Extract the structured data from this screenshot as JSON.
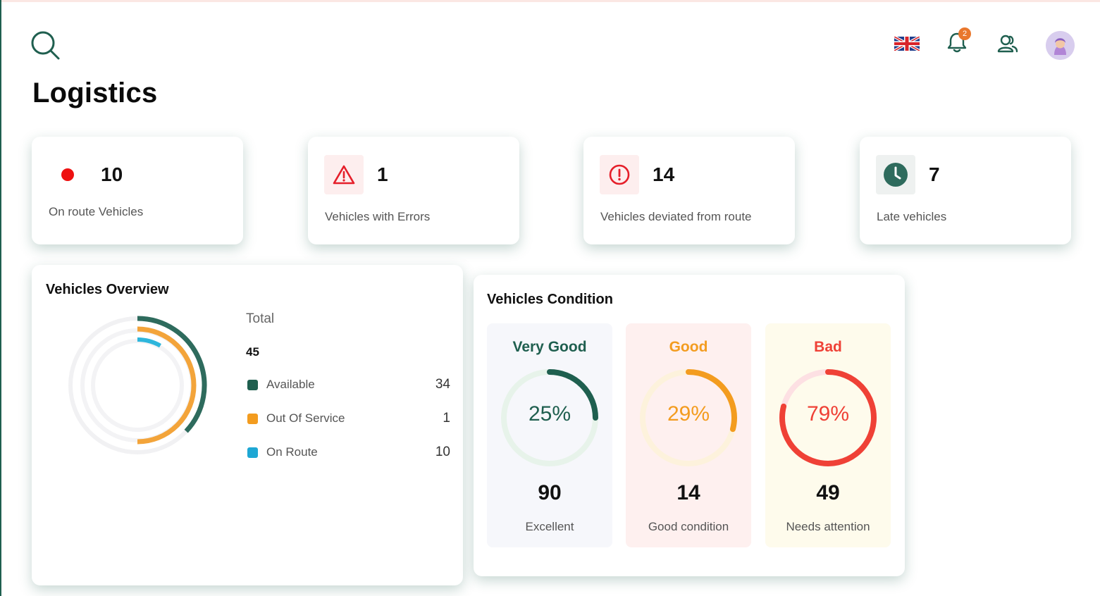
{
  "page": {
    "title": "Logistics"
  },
  "header": {
    "icons": {
      "search": "search-icon",
      "language": "uk-flag-icon",
      "notifications": "bell-icon",
      "users": "users-icon",
      "avatar": "avatar"
    },
    "notification_count": "2"
  },
  "stats": [
    {
      "value": "10",
      "label": "On route Vehicles",
      "icon": "red-dot-icon",
      "color": "#ee1111"
    },
    {
      "value": "1",
      "label": "Vehicles with Errors",
      "icon": "warning-triangle-icon",
      "color": "#e51f2a"
    },
    {
      "value": "14",
      "label": "Vehicles deviated from route",
      "icon": "exclamation-circle-icon",
      "color": "#e51f2a"
    },
    {
      "value": "7",
      "label": "Late vehicles",
      "icon": "clock-icon",
      "color": "#2e6b5d"
    }
  ],
  "overview": {
    "title": "Vehicles Overview",
    "total_label": "Total",
    "total_value": "45",
    "legend": [
      {
        "label": "Available",
        "value": "34",
        "color": "#1f5f4f"
      },
      {
        "label": "Out Of Service",
        "value": "1",
        "color": "#f39c1f"
      },
      {
        "label": "On Route",
        "value": "10",
        "color": "#1ea7d4"
      }
    ]
  },
  "condition": {
    "title": "Vehicles Condition",
    "items": [
      {
        "name": "Very Good",
        "percent": "25%",
        "fraction": 0.25,
        "count": "90",
        "caption": "Excellent",
        "color": "#1f5f4f",
        "track": "#e7f3ea",
        "bg": "#f6f7fb"
      },
      {
        "name": "Good",
        "percent": "29%",
        "fraction": 0.29,
        "count": "14",
        "caption": "Good condition",
        "color": "#f39c1f",
        "track": "#fdf2dc",
        "bg": "#fef0ef"
      },
      {
        "name": "Bad",
        "percent": "79%",
        "fraction": 0.79,
        "count": "49",
        "caption": "Needs attention",
        "color": "#ef4136",
        "track": "#fde0e3",
        "bg": "#fefbec"
      }
    ]
  }
}
